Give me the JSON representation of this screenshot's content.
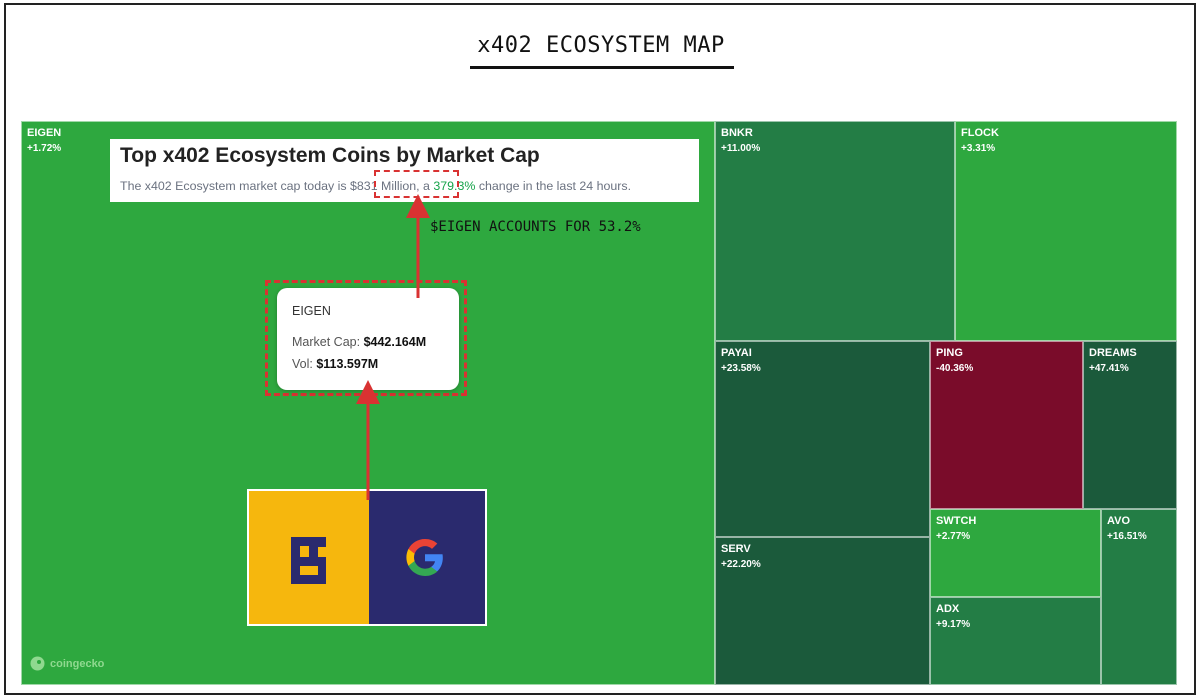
{
  "page": {
    "title": "x402 ECOSYSTEM MAP"
  },
  "header": {
    "title": "Top x402 Ecosystem Coins by Market Cap",
    "subtitle_prefix": "The x402 Ecosystem market cap today is ",
    "market_cap": "$831 Million",
    "subtitle_mid": ", a ",
    "change_pct": "379.3%",
    "subtitle_suffix": " change in the last 24 hours."
  },
  "annotation": "$EIGEN ACCOUNTS FOR 53.2%",
  "tooltip": {
    "name": "EIGEN",
    "market_cap_label": "Market Cap: ",
    "market_cap": "$442.164M",
    "vol_label": "Vol: ",
    "vol": "$113.597M"
  },
  "logos": {
    "left": "eigenlayer-logo-icon",
    "right": "google-g-logo-icon"
  },
  "watermark": "coingecko",
  "colors": {
    "positive_bright": "#2ea83f",
    "positive_mid": "#237d45",
    "positive_dark": "#1b5a3b",
    "negative": "#7a0c2a",
    "annotation_red": "#d93232"
  },
  "chart_data": {
    "type": "treemap",
    "title": "x402 ECOSYSTEM MAP",
    "items": [
      {
        "name": "EIGEN",
        "change": "+1.72%",
        "color": "#2ea83f"
      },
      {
        "name": "BNKR",
        "change": "+11.00%",
        "color": "#237d45"
      },
      {
        "name": "FLOCK",
        "change": "+3.31%",
        "color": "#2ea83f"
      },
      {
        "name": "PAYAI",
        "change": "+23.58%",
        "color": "#1b5a3b"
      },
      {
        "name": "PING",
        "change": "-40.36%",
        "color": "#7a0c2a"
      },
      {
        "name": "DREAMS",
        "change": "+47.41%",
        "color": "#1b5a3b"
      },
      {
        "name": "SERV",
        "change": "+22.20%",
        "color": "#1b5a3b"
      },
      {
        "name": "SWTCH",
        "change": "+2.77%",
        "color": "#2ea83f"
      },
      {
        "name": "AVO",
        "change": "+16.51%",
        "color": "#237d45"
      },
      {
        "name": "ADX",
        "change": "+9.17%",
        "color": "#237d45"
      }
    ]
  }
}
